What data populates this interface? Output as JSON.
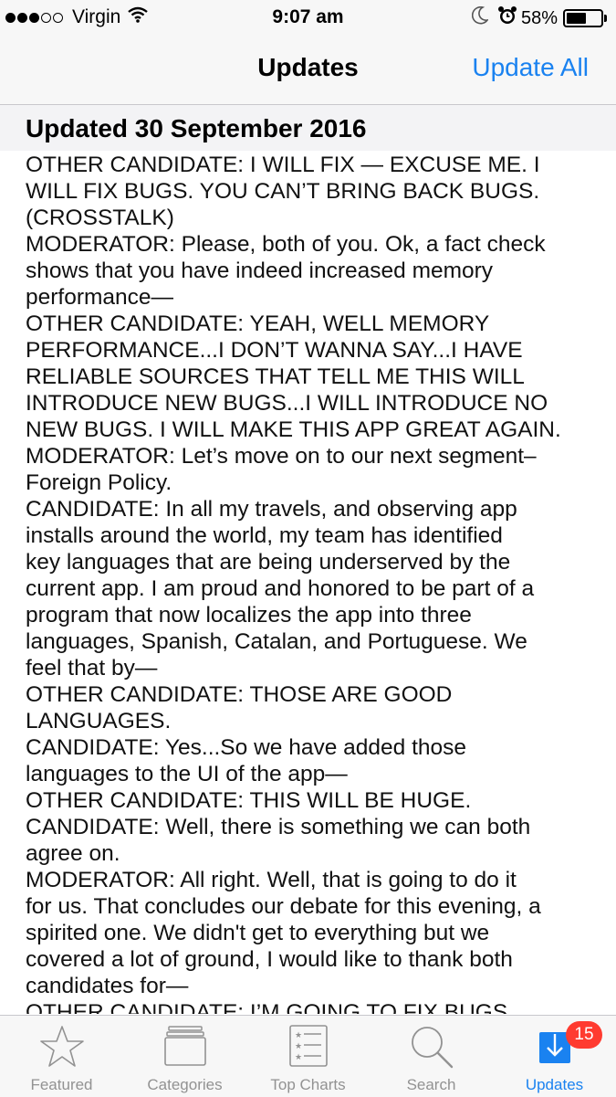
{
  "status_bar": {
    "signal_bars_filled": 3,
    "signal_bars_total": 5,
    "carrier": "Virgin",
    "time": "9:07 am",
    "battery_percent": "58%",
    "battery_level": 0.58,
    "icons": [
      "wifi-icon",
      "moon-icon",
      "alarm-icon",
      "battery-icon"
    ]
  },
  "nav": {
    "title": "Updates",
    "action": "Update All"
  },
  "section": {
    "title": "Updated 30 September 2016"
  },
  "notes": {
    "lines": [
      "OTHER CANDIDATE: I WILL FIX — EXCUSE ME. I",
      "WILL FIX BUGS. YOU CAN’T BRING BACK BUGS.",
      "(CROSSTALK)",
      "MODERATOR: Please, both of you. Ok, a fact check",
      "shows that you have indeed increased memory",
      "performance—",
      "OTHER CANDIDATE: YEAH, WELL MEMORY",
      "PERFORMANCE...I DON’T WANNA SAY...I HAVE",
      "RELIABLE SOURCES THAT TELL ME THIS WILL",
      "INTRODUCE NEW BUGS...I WILL INTRODUCE NO",
      "NEW BUGS. I WILL MAKE THIS APP GREAT AGAIN.",
      "MODERATOR: Let’s move on to our next segment–",
      "Foreign Policy.",
      "CANDIDATE: In all my travels, and observing app",
      "installs around the world, my team has identified",
      "key languages that are being underserved by the",
      "current app. I am proud and honored to be part of a",
      "program that now localizes the app into three",
      "languages, Spanish, Catalan, and Portuguese. We",
      "feel that by—",
      "OTHER CANDIDATE: THOSE ARE GOOD",
      "LANGUAGES.",
      "CANDIDATE: Yes...So we have added those",
      "languages to the UI of the app—",
      "OTHER CANDIDATE: THIS WILL BE HUGE.",
      "CANDIDATE: Well, there is something we can both",
      "agree on.",
      "MODERATOR: All right. Well, that is going to do it",
      "for us. That concludes our debate for this evening, a",
      "spirited one. We didn't get to everything but we",
      "covered a lot of ground, I would like to thank both",
      "candidates for—",
      "OTHER CANDIDATE: I’M GOING TO FIX BUGS."
    ]
  },
  "tabs": [
    {
      "label": "Featured",
      "icon": "star-icon",
      "active": false
    },
    {
      "label": "Categories",
      "icon": "categories-icon",
      "active": false
    },
    {
      "label": "Top Charts",
      "icon": "top-charts-icon",
      "active": false
    },
    {
      "label": "Search",
      "icon": "search-icon",
      "active": false
    },
    {
      "label": "Updates",
      "icon": "updates-icon",
      "active": true,
      "badge": "15"
    }
  ],
  "colors": {
    "accent": "#1a82f0",
    "inactive": "#929292",
    "badge": "#ff3b30",
    "bar_background": "#f7f7f7"
  }
}
